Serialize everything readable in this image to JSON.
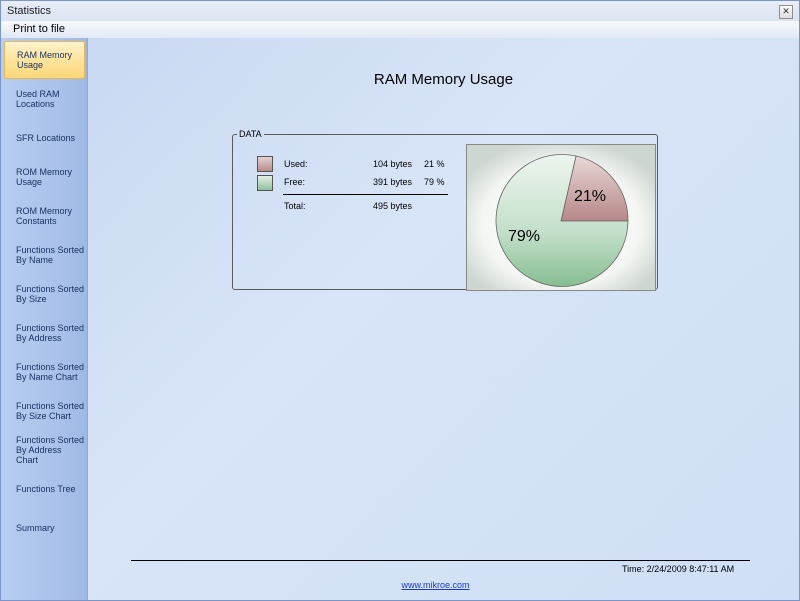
{
  "window": {
    "title": "Statistics"
  },
  "menu": {
    "print_to_file": "Print to file"
  },
  "sidebar": {
    "items": [
      {
        "label": "RAM Memory\nUsage",
        "active": true
      },
      {
        "label": "Used RAM\nLocations"
      },
      {
        "label": "SFR Locations"
      },
      {
        "label": "ROM Memory\nUsage"
      },
      {
        "label": "ROM Memory\nConstants"
      },
      {
        "label": "Functions Sorted\nBy  Name"
      },
      {
        "label": "Functions Sorted\nBy Size"
      },
      {
        "label": "Functions Sorted\nBy Address"
      },
      {
        "label": "Functions Sorted\nBy Name Chart"
      },
      {
        "label": "Functions Sorted\nBy Size Chart"
      },
      {
        "label": "Functions Sorted\nBy Address Chart"
      },
      {
        "label": "Functions Tree"
      },
      {
        "label": "Summary"
      }
    ]
  },
  "main": {
    "title": "RAM Memory Usage",
    "data_label": "DATA",
    "used": {
      "label": "Used:",
      "bytes": "104 bytes",
      "percent": "21 %"
    },
    "free": {
      "label": "Free:",
      "bytes": "391 bytes",
      "percent": "79 %"
    },
    "total": {
      "label": "Total:",
      "bytes": "495 bytes"
    },
    "time": "Time: 2/24/2009 8:47:11 AM",
    "link": "www.mikroe.com"
  },
  "chart_data": {
    "type": "pie",
    "categories": [
      "Used",
      "Free"
    ],
    "values": [
      21,
      79
    ],
    "labels": [
      "21%",
      "79%"
    ],
    "colors": [
      "#b98b8b",
      "#8fc29a"
    ]
  }
}
